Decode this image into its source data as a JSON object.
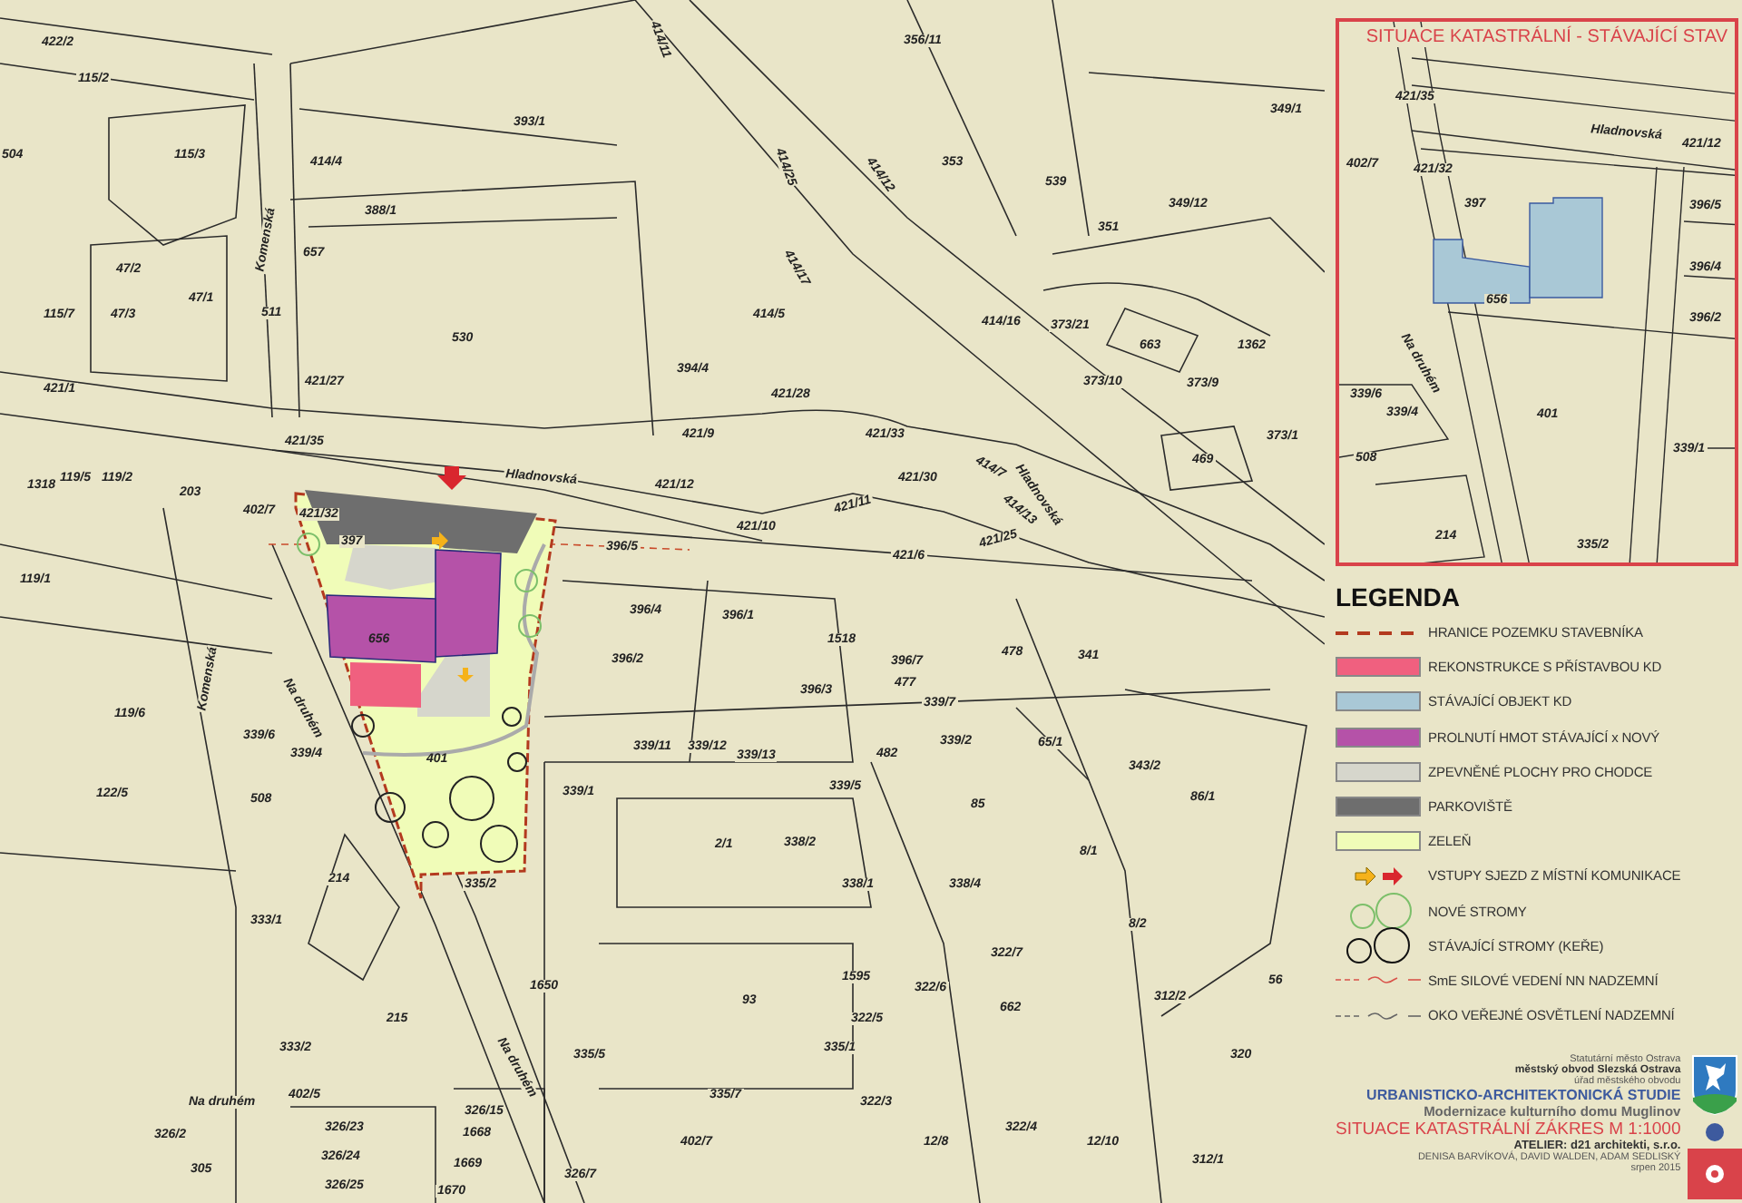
{
  "map": {
    "parcel_numbers": [
      "422/2",
      "115/2",
      "504",
      "115/3",
      "414/4",
      "393/1",
      "388/1",
      "47/2",
      "47/1",
      "115/7",
      "47/3",
      "657",
      "530",
      "511",
      "421/27",
      "421/1",
      "421/35",
      "119/5",
      "119/2",
      "1318",
      "203",
      "402/7",
      "119/1",
      "119/6",
      "122/5",
      "333/1",
      "214",
      "215",
      "333/2",
      "1650",
      "93",
      "335/1",
      "335/5",
      "335/7",
      "402/7",
      "326/15",
      "326/23",
      "326/24",
      "326/25",
      "1668",
      "1669",
      "1670",
      "305",
      "326/2",
      "326/7",
      "402/5",
      "421/12",
      "421/9",
      "421/28",
      "394/4",
      "414/5",
      "421/33",
      "421/30",
      "421/11",
      "421/10",
      "421/6",
      "421/25",
      "396/5",
      "396/4",
      "396/1",
      "396/2",
      "1518",
      "396/3",
      "396/7",
      "477",
      "478",
      "341",
      "339/7",
      "339/11",
      "339/12",
      "339/13",
      "482",
      "339/2",
      "339/5",
      "339/1",
      "85",
      "2/1",
      "338/2",
      "338/1",
      "338/4",
      "401",
      "656",
      "397",
      "421/32",
      "335/2",
      "339/4",
      "339/6",
      "508",
      "343/2",
      "86/1",
      "8/1",
      "8/2",
      "1595",
      "322/6",
      "322/7",
      "662",
      "322/5",
      "322/3",
      "12/8",
      "322/4",
      "12/10",
      "312/2",
      "320",
      "56",
      "65/1",
      "356/11",
      "353",
      "539",
      "349/12",
      "349/1",
      "351",
      "414/16",
      "373/21",
      "663",
      "373/10",
      "373/9",
      "1362",
      "373/1",
      "469",
      "414/12",
      "414/25",
      "414/17",
      "414/11",
      "414/13",
      "414/7",
      "312/1"
    ],
    "street_names": [
      "Hladnovská",
      "Hladnovská",
      "Komenská",
      "Na druhém",
      "Komenská",
      "Na druhém",
      "Na druhém"
    ]
  },
  "inset": {
    "title": "SITUACE KATASTRÁLNÍ - STÁVAJÍCÍ STAV",
    "parcel_numbers": [
      "421/35",
      "421/12",
      "402/7",
      "421/32",
      "397",
      "396/5",
      "396/4",
      "396/2",
      "656",
      "401",
      "339/6",
      "339/4",
      "508",
      "339/1",
      "214",
      "335/2"
    ],
    "street_names": [
      "Hladnovská",
      "Na druhém"
    ]
  },
  "legend": {
    "title": "LEGENDA",
    "items": [
      {
        "kind": "boundary-line",
        "label": "HRANICE POZEMKU STAVEBNÍKA"
      },
      {
        "kind": "swatch",
        "color": "#f0607f",
        "label": "REKONSTRUKCE S PŘÍSTAVBOU KD"
      },
      {
        "kind": "swatch",
        "color": "#a9c8d6",
        "label": "STÁVAJÍCÍ OBJEKT KD"
      },
      {
        "kind": "swatch",
        "color": "#b552a8",
        "label": "PROLNUTÍ HMOT STÁVAJÍCÍ x NOVÝ"
      },
      {
        "kind": "swatch",
        "color": "#d6d6cc",
        "label": "ZPEVNĚNÉ PLOCHY PRO CHODCE"
      },
      {
        "kind": "swatch",
        "color": "#6e6e6e",
        "label": "PARKOVIŠTĚ"
      },
      {
        "kind": "swatch",
        "color": "#f0fcb8",
        "label": "ZELEŇ"
      },
      {
        "kind": "arrows",
        "label": "VSTUPY SJEZD Z MÍSTNÍ KOMUNIKACE"
      },
      {
        "kind": "new-trees",
        "label": "NOVÉ STROMY"
      },
      {
        "kind": "existing-trees",
        "label": "STÁVAJÍCÍ STROMY (KEŘE)"
      },
      {
        "kind": "power-line",
        "label": "SmE SILOVÉ VEDENÍ NN NADZEMNÍ"
      },
      {
        "kind": "light-line",
        "label": "OKO VEŘEJNÉ OSVĚTLENÍ NADZEMNÍ"
      }
    ]
  },
  "title_block": {
    "lines": [
      {
        "kind": "small",
        "text": "Statutární město Ostrava"
      },
      {
        "kind": "small-bold",
        "text": "městský obvod Slezská Ostrava"
      },
      {
        "kind": "small",
        "text": "úřad městského obvodu"
      },
      {
        "kind": "study",
        "text": "URBANISTICKO-ARCHITEKTONICKÁ STUDIE"
      },
      {
        "kind": "project",
        "text": "Modernizace kulturního domu Muglinov"
      },
      {
        "kind": "drawing-title",
        "text": "SITUACE KATASTRÁLNÍ ZÁKRES M 1:1000"
      },
      {
        "kind": "atelier",
        "text": "ATELIER:  d21 architekti, s.r.o."
      },
      {
        "kind": "small",
        "text": "DENISA BARVÍKOVÁ, DAVID WALDEN, ADAM SEDLISKÝ"
      },
      {
        "kind": "small",
        "text": "srpen 2015"
      }
    ]
  }
}
